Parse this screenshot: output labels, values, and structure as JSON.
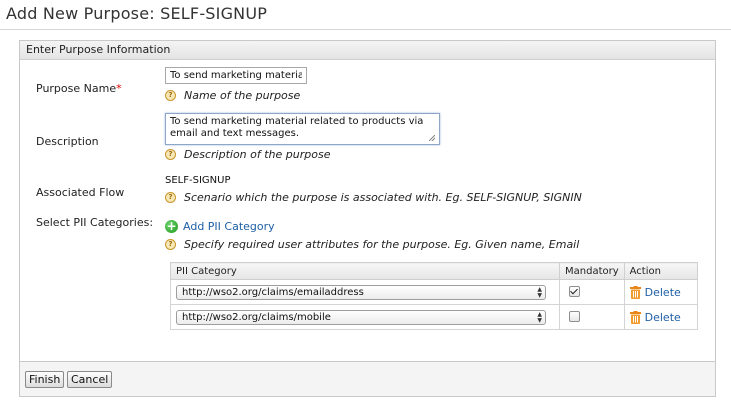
{
  "page": {
    "title": "Add New Purpose: SELF-SIGNUP"
  },
  "panel": {
    "header": "Enter Purpose Information"
  },
  "form": {
    "purpose_name": {
      "label": "Purpose Name",
      "required_mark": "*",
      "value": "To send marketing material",
      "help": "Name of the purpose"
    },
    "description": {
      "label": "Description",
      "value": "To send marketing material related to products via email and text messages.",
      "help": "Description of the purpose"
    },
    "associated_flow": {
      "label": "Associated Flow",
      "value": "SELF-SIGNUP",
      "help": "Scenario which the purpose is associated with. Eg. SELF-SIGNUP, SIGNIN"
    },
    "pii": {
      "label": "Select PII Categories:",
      "add_label": "Add PII Category",
      "help": "Specify required user attributes for the purpose. Eg. Given name, Email"
    }
  },
  "table": {
    "headers": {
      "category": "PII Category",
      "mandatory": "Mandatory",
      "action": "Action"
    },
    "rows": [
      {
        "category": "http://wso2.org/claims/emailaddress",
        "mandatory": true,
        "action": "Delete"
      },
      {
        "category": "http://wso2.org/claims/mobile",
        "mandatory": false,
        "action": "Delete"
      }
    ]
  },
  "buttons": {
    "finish": "Finish",
    "cancel": "Cancel"
  },
  "icons": {
    "help": "help-icon",
    "add": "add-circle-icon",
    "delete": "trash-icon"
  },
  "colors": {
    "link": "#1f5fa5",
    "required": "#dd0000",
    "help_icon": "#c9962c",
    "add_icon": "#1d9a1d",
    "trash": "#e8861c"
  }
}
